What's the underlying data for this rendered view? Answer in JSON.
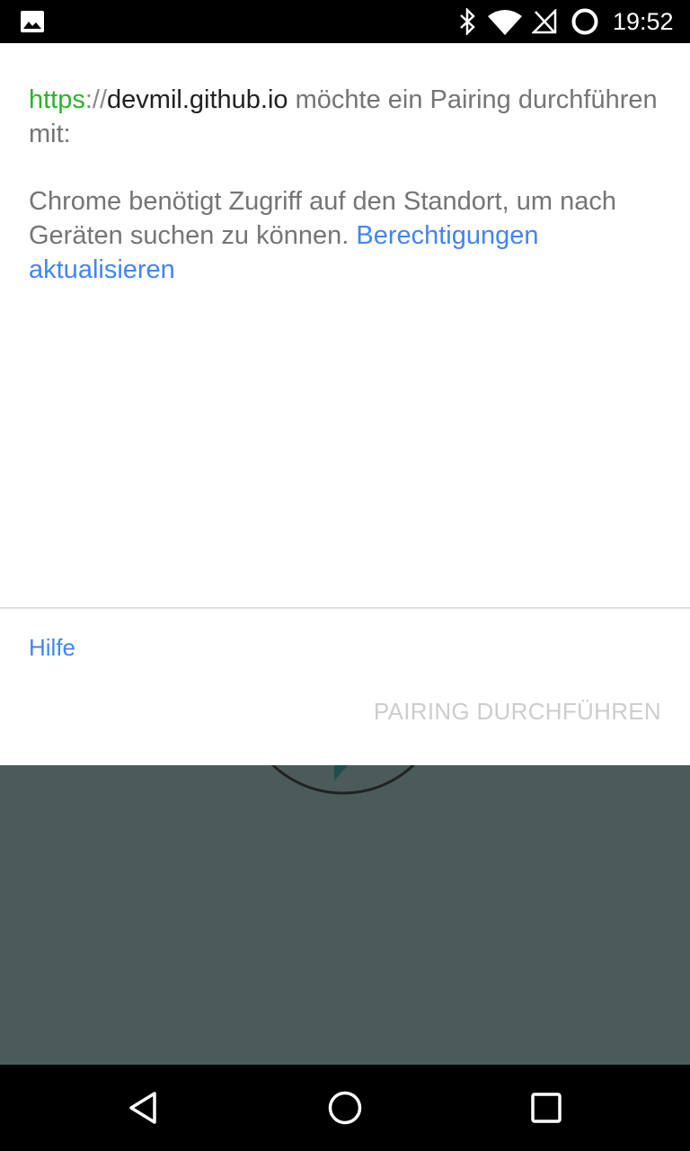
{
  "status_bar": {
    "time": "19:52",
    "icons": [
      "image-notification-icon",
      "bluetooth-icon",
      "wifi-icon",
      "no-signal-icon",
      "battery-icon"
    ]
  },
  "dialog": {
    "origin_scheme": "https",
    "origin_separator": "://",
    "origin_host": "devmil.github.io",
    "title_suffix": " möchte ein Pairing durchführen mit:",
    "message_text": "Chrome benötigt Zugriff auf den Standort, um nach Geräten suchen zu können. ",
    "permissions_link": "Berechtigungen aktualisieren",
    "help_link": "Hilfe",
    "pair_button": "PAIRING DURCHFÜHREN"
  },
  "colors": {
    "scheme_green": "#2cb32c",
    "link_blue": "#4285f4",
    "disabled_button": "#cdcdcd",
    "background_app": "#4a5b5a"
  },
  "nav_bar": {
    "icons": [
      "back-icon",
      "home-icon",
      "recents-icon"
    ]
  }
}
